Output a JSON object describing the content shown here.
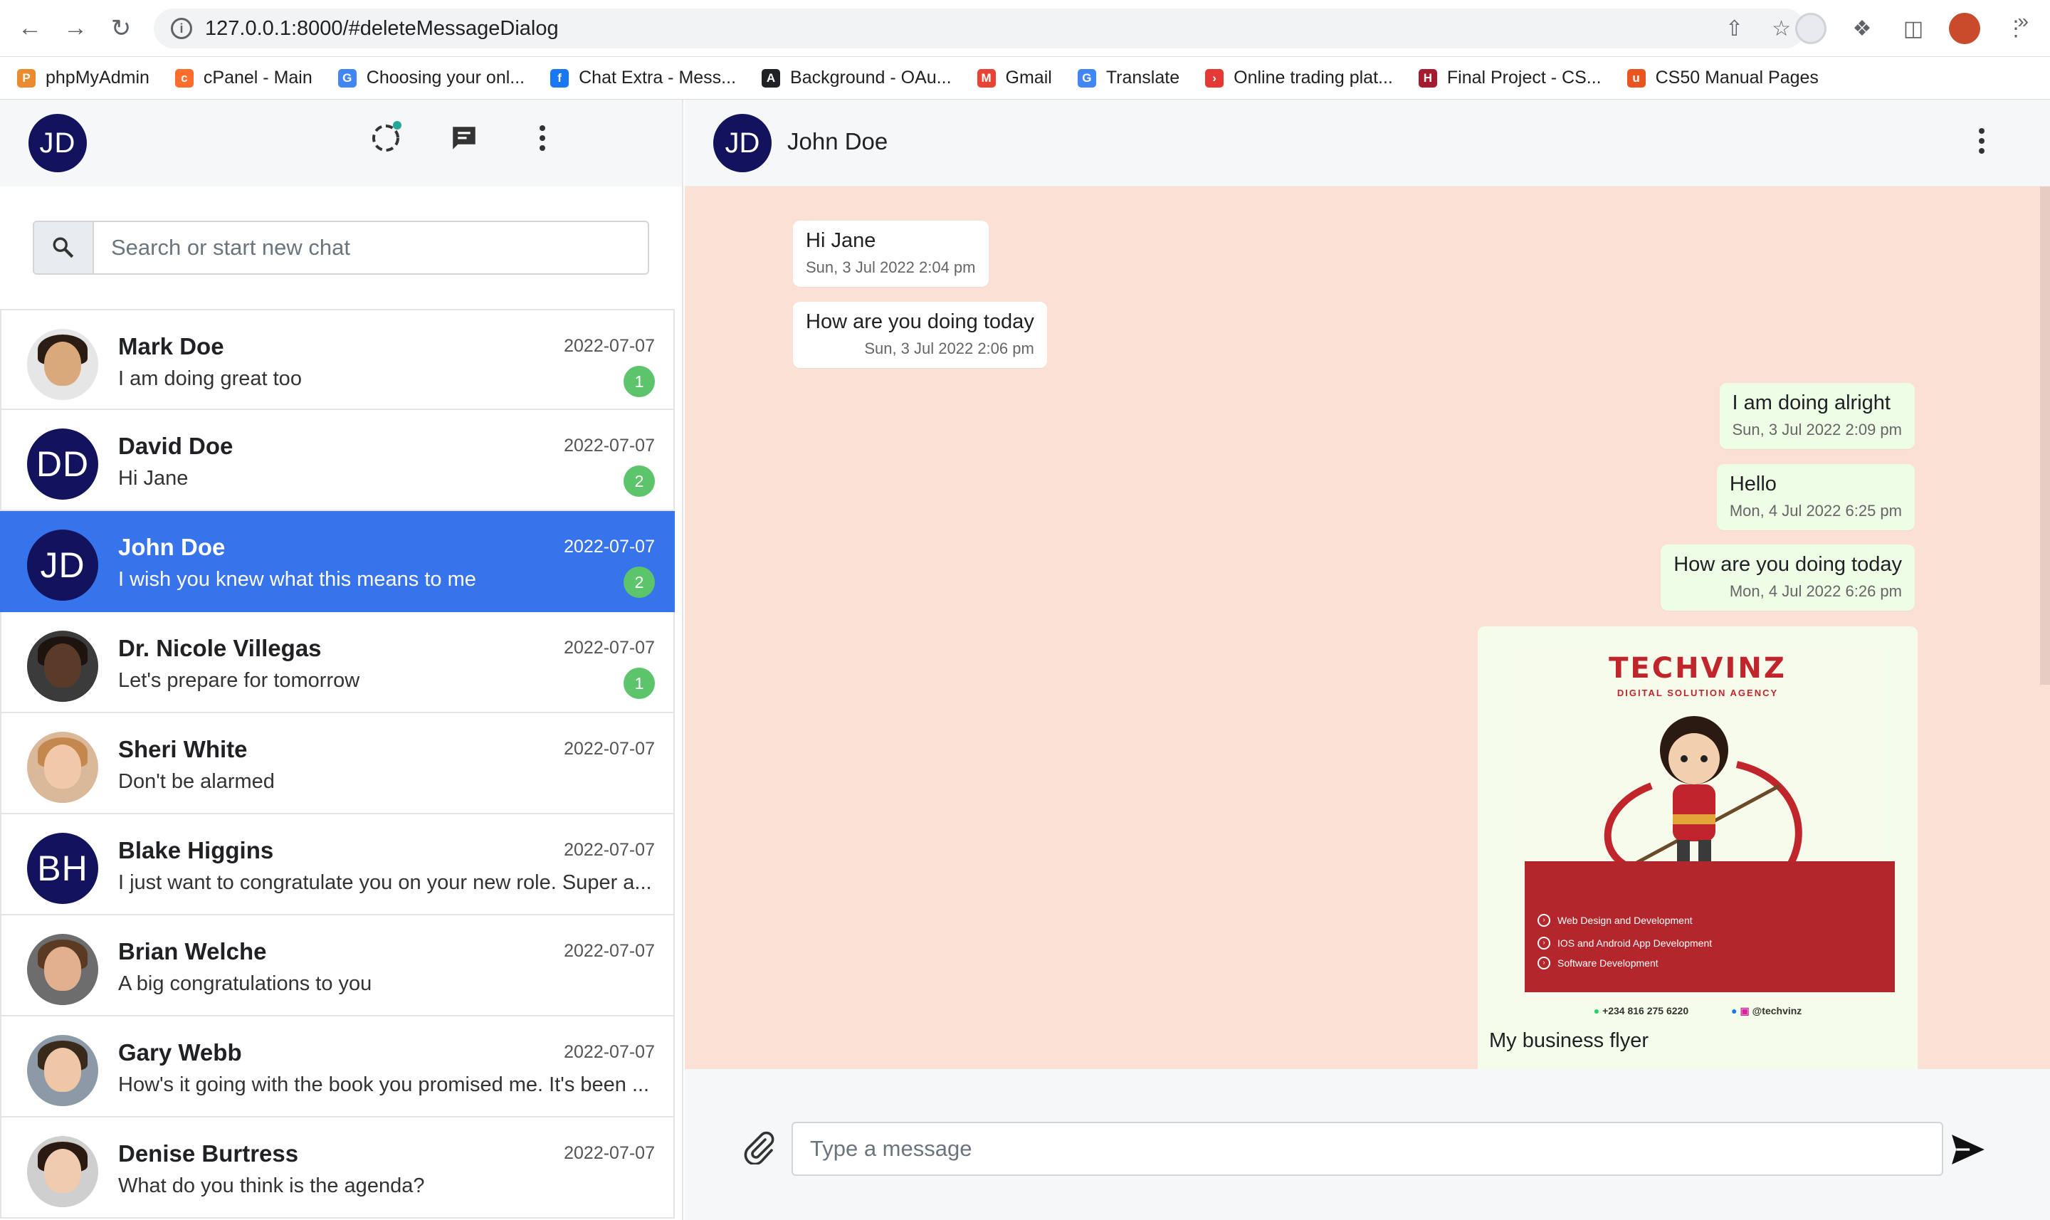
{
  "browser": {
    "url": "127.0.0.1:8000/#deleteMessageDialog",
    "bookmarks": [
      {
        "label": "phpMyAdmin",
        "icon": "phpmyadmin-icon",
        "color": "#e98b2e",
        "glyph": "P"
      },
      {
        "label": "cPanel - Main",
        "icon": "cpanel-icon",
        "color": "#ff6c2c",
        "glyph": "c"
      },
      {
        "label": "Choosing your onl...",
        "icon": "google-icon",
        "color": "#4285f4",
        "glyph": "G"
      },
      {
        "label": "Chat Extra - Mess...",
        "icon": "facebook-icon",
        "color": "#1877f2",
        "glyph": "f"
      },
      {
        "label": "Background - OAu...",
        "icon": "oauth-icon",
        "color": "#202124",
        "glyph": "A"
      },
      {
        "label": "Gmail",
        "icon": "gmail-icon",
        "color": "#ea4335",
        "glyph": "M"
      },
      {
        "label": "Translate",
        "icon": "translate-icon",
        "color": "#4285f4",
        "glyph": "G"
      },
      {
        "label": "Online trading plat...",
        "icon": "trading-icon",
        "color": "#e53935",
        "glyph": "›"
      },
      {
        "label": "Final Project - CS...",
        "icon": "harvard-icon",
        "color": "#a51c30",
        "glyph": "H"
      },
      {
        "label": "CS50 Manual Pages",
        "icon": "ubuntu-icon",
        "color": "#e95420",
        "glyph": "u"
      }
    ]
  },
  "user": {
    "initials": "JD"
  },
  "search": {
    "placeholder": "Search or start new chat"
  },
  "chats": [
    {
      "name": "Mark Doe",
      "message": "I am doing great too",
      "date": "2022-07-07",
      "unread": "1",
      "avatar": "photo",
      "skin": "#d9a97c",
      "hair": "#2b1d14",
      "shirt": "#e6e6e6"
    },
    {
      "name": "David Doe",
      "message": "Hi Jane",
      "date": "2022-07-07",
      "unread": "2",
      "avatar": "initials",
      "initials": "DD"
    },
    {
      "name": "John Doe",
      "message": "I wish you knew what this means to me",
      "date": "2022-07-07",
      "unread": "2",
      "avatar": "initials",
      "initials": "JD",
      "active": true
    },
    {
      "name": "Dr. Nicole Villegas",
      "message": "Let's prepare for tomorrow",
      "date": "2022-07-07",
      "unread": "1",
      "avatar": "photo",
      "skin": "#5a3b2a",
      "hair": "#1d1410",
      "shirt": "#3b3b3b"
    },
    {
      "name": "Sheri White",
      "message": "Don't be alarmed",
      "date": "2022-07-07",
      "unread": "",
      "avatar": "photo",
      "skin": "#f0c9a8",
      "hair": "#c4874d",
      "shirt": "#d9b99a"
    },
    {
      "name": "Blake Higgins",
      "message": "I just want to congratulate you on your new role. Super a...",
      "date": "2022-07-07",
      "unread": "",
      "avatar": "initials",
      "initials": "BH"
    },
    {
      "name": "Brian Welche",
      "message": "A big congratulations to you",
      "date": "2022-07-07",
      "unread": "",
      "avatar": "photo",
      "skin": "#e2b08e",
      "hair": "#5a3a22",
      "shirt": "#6d6d6d"
    },
    {
      "name": "Gary Webb",
      "message": "How's it going with the book you promised me. It's been ...",
      "date": "2022-07-07",
      "unread": "",
      "avatar": "photo",
      "skin": "#efc7a7",
      "hair": "#3a2a1c",
      "shirt": "#8c9aa8"
    },
    {
      "name": "Denise Burtress",
      "message": "What do you think is the agenda?",
      "date": "2022-07-07",
      "unread": "",
      "avatar": "photo",
      "skin": "#f0cbb0",
      "hair": "#2a1a12",
      "shirt": "#cfcfcf"
    }
  ],
  "conversation": {
    "name": "John Doe",
    "initials": "JD",
    "messages": [
      {
        "dir": "in",
        "text": "Hi Jane",
        "time": "Sun, 3 Jul 2022 2:04 pm"
      },
      {
        "dir": "in",
        "text": "How are you doing today",
        "time": "Sun, 3 Jul 2022 2:06 pm"
      },
      {
        "dir": "out",
        "text": "I am doing alright",
        "time": "Sun, 3 Jul 2022 2:09 pm"
      },
      {
        "dir": "out",
        "text": "Hello",
        "time": "Mon, 4 Jul 2022 6:25 pm"
      },
      {
        "dir": "out",
        "text": "How are you doing today",
        "time": "Mon, 4 Jul 2022 6:26 pm"
      }
    ],
    "image_message": {
      "caption": "My business flyer",
      "flyer": {
        "title": "TECHVINZ",
        "subtitle": "DIGITAL SOLUTION AGENCY",
        "services": [
          "Web Design and Development",
          "IOS and Android App Development",
          "Software Development"
        ],
        "phone": "+234 816 275 6220",
        "handle": "@techvinz"
      }
    }
  },
  "composer": {
    "placeholder": "Type a message"
  }
}
